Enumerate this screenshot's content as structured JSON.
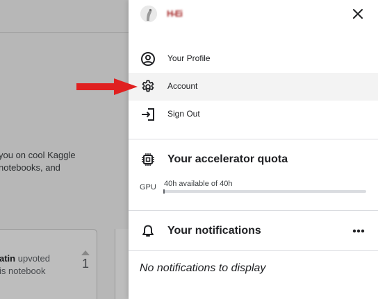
{
  "background": {
    "intro_line1": "you on cool Kaggle",
    "intro_line2": " notebooks, and",
    "card_user": "atin",
    "card_action": " upvoted",
    "card_line2": "is notebook",
    "card_votes": "1"
  },
  "header": {
    "username": "H-Ei",
    "close_icon": "close-icon"
  },
  "menu": {
    "items": [
      {
        "label": "Your Profile",
        "icon": "user-circle-icon"
      },
      {
        "label": "Account",
        "icon": "gear-icon"
      },
      {
        "label": "Sign Out",
        "icon": "sign-out-icon"
      }
    ]
  },
  "accelerator": {
    "title": "Your accelerator quota",
    "gpu_label": "GPU",
    "gpu_text": "40h available of 40h",
    "gpu_used_fraction": 0.0,
    "icon": "chip-icon"
  },
  "notifications": {
    "title": "Your notifications",
    "empty_text": "No notifications to display",
    "icon": "bell-icon",
    "more_icon": "more-horizontal-icon"
  },
  "colors": {
    "arrow": "#e02020",
    "divider": "#dadce0",
    "active_row": "#f3f3f3"
  }
}
